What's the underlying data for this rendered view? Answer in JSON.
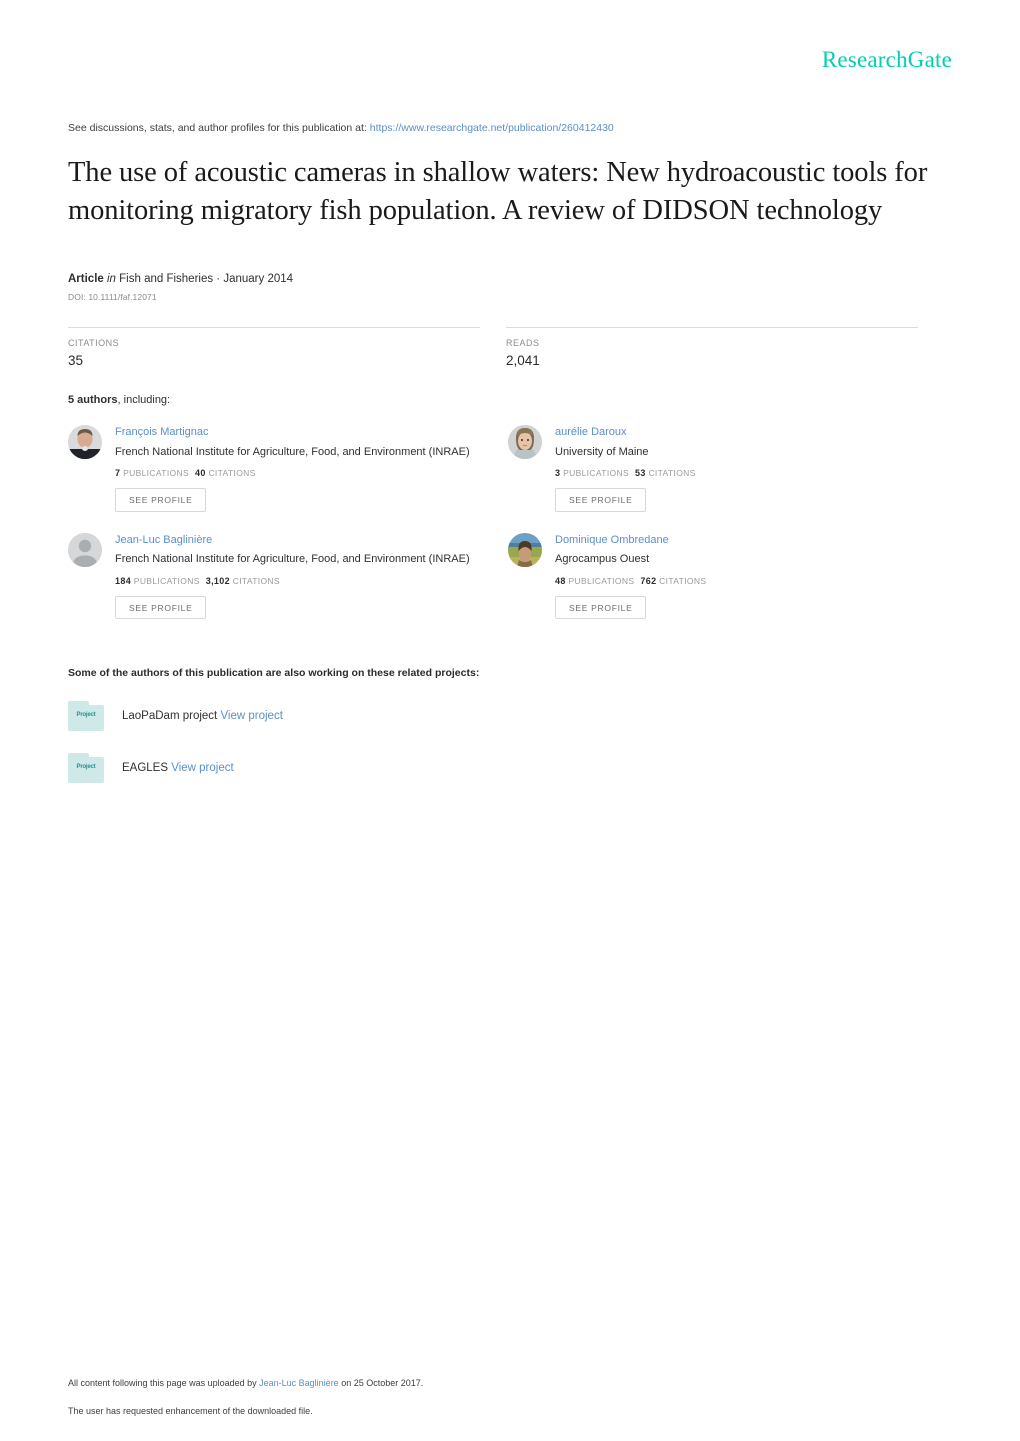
{
  "header": {
    "logo_text": "ResearchGate",
    "logo_color": "#00d0af",
    "discussion_prefix": "See discussions, stats, and author profiles for this publication at:",
    "discussion_url": "https://www.researchgate.net/publication/260412430"
  },
  "publication": {
    "title": "The use of acoustic cameras in shallow waters: New hydroacoustic tools for monitoring migratory fish population. A review of DIDSON technology",
    "type_label": "Article",
    "in_word": "in",
    "journal": "Fish and Fisheries · January 2014",
    "doi": "DOI: 10.1111/faf.12071"
  },
  "stats": {
    "citations_label": "CITATIONS",
    "citations_value": "35",
    "reads_label": "READS",
    "reads_value": "2,041"
  },
  "authors_section": {
    "count_text": "5 authors",
    "including_text": ", including:",
    "see_profile_label": "SEE PROFILE",
    "publications_word": "PUBLICATIONS",
    "citations_word": "CITATIONS"
  },
  "authors": [
    {
      "name": "François Martignac",
      "affiliation": "French National Institute for Agriculture, Food, and Environment (INRAE)",
      "publications": "7",
      "citations": "40",
      "avatar": "photo-man"
    },
    {
      "name": "aurélie Daroux",
      "affiliation": "University of Maine",
      "publications": "3",
      "citations": "53",
      "avatar": "photo-woman"
    },
    {
      "name": "Jean-Luc Baglinière",
      "affiliation": "French National Institute for Agriculture, Food, and Environment (INRAE)",
      "publications": "184",
      "citations": "3,102",
      "avatar": "placeholder"
    },
    {
      "name": "Dominique Ombredane",
      "affiliation": "Agrocampus Ouest",
      "publications": "48",
      "citations": "762",
      "avatar": "photo-outdoor"
    }
  ],
  "projects_section": {
    "heading": "Some of the authors of this publication are also working on these related projects:",
    "folder_icon_text": "Project",
    "view_project_label": "View project"
  },
  "projects": [
    {
      "name": "LaoPaDam project"
    },
    {
      "name": "EAGLES"
    }
  ],
  "footer": {
    "upload_prefix": "All content following this page was uploaded by",
    "upload_author": "Jean-Luc Baglinière",
    "upload_suffix": "on 25 October 2017.",
    "enhancement_note": "The user has requested enhancement of the downloaded file."
  }
}
